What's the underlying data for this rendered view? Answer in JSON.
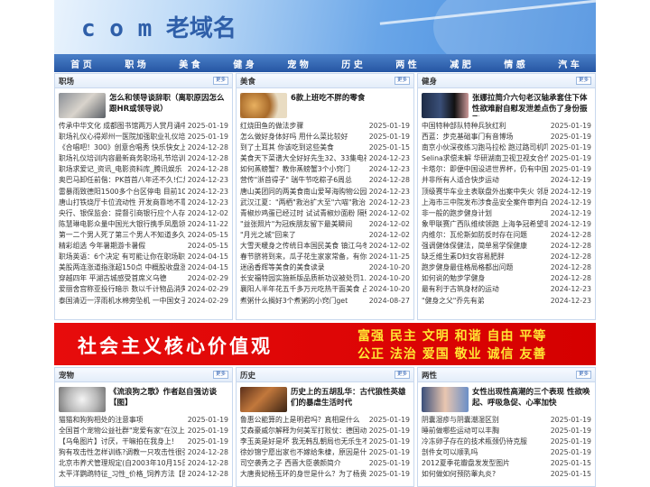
{
  "site": {
    "title": "c o m 老域名"
  },
  "nav": [
    "首 页",
    "职 场",
    "美 食",
    "健 身",
    "宠 物",
    "历 史",
    "两 性",
    "减 肥",
    "情 感",
    "汽 车"
  ],
  "more_label": "更多",
  "boxes": [
    {
      "title": "职场",
      "feature": "怎么和领导谈辞职（离职原因怎么跟HR或领导说）",
      "items": [
        [
          "传承中华文化 成都图书馆两万人赏月诵中秋",
          "2025-01-19"
        ],
        [
          "职场礼仪心得郑州一医院加强职业礼仪培训",
          "2025-01-19"
        ],
        [
          "《合唱吧！300》创意合唱秀 快乐快女上演\"回",
          "2024-12-28"
        ],
        [
          "职场礼仪培训内容最新商务职场礼节培训",
          "2024-12-28"
        ],
        [
          "职场求爱记_资讯_电影资料库_腾讯娱乐",
          "2024-12-28"
        ],
        [
          "奥巴马卸任前偕：PK首首八年还不久!仁加 北晚新",
          "2024-12-23"
        ],
        [
          "雷暴雨致德阳1500多个台区停电 目前10万户",
          "2024-12-23"
        ],
        [
          "唐山打铁烧厅卡位流动性 开发商靠地不靠地\"都",
          "2024-12-23"
        ],
        [
          "央行、银保监会：提督引商银行应个人存取自由",
          "2024-12-02"
        ],
        [
          "陈慧琳电影众量中国光大银行携手凤凰领套 共",
          "2024-11-22"
        ],
        [
          "第一二个男人死了第三个男人不知道多久职场礼",
          "2024-05-15"
        ],
        [
          "精彩组选 今年暑期游卡暑假",
          "2024-05-15"
        ],
        [
          "职场英语：6个决定 有可能让你在职场职场英语",
          "2024-04-15"
        ],
        [
          "美股两连涨道指涨超150点 中概股收盘涨跌不一",
          "2024-04-15"
        ],
        [
          "穿越四年 平湖古城感受首席义乌德",
          "2024-02-29"
        ],
        [
          "爱丽舍宫称亚投行暗示 数以千计物品消失",
          "2024-02-29"
        ],
        [
          "泰国清迈一浮雨机水棉旁坠机 一中国女子受轻",
          "2024-02-29"
        ]
      ]
    },
    {
      "title": "美食",
      "feature": "6款上班吃不胖的零食",
      "items": [
        [
          "红烧田鱼的做法步骤",
          "2025-01-19"
        ],
        [
          "怎么做好身体好吗 用什么菜比较好",
          "2025-01-19"
        ],
        [
          "到了土耳其 你该吃到这些美食",
          "2025-01-15"
        ],
        [
          "美食天下菜谱大全好好先生32、33集电视剧全集",
          "2024-12-23"
        ],
        [
          "如何蒸螃蟹？教你蒸螃蟹3个小窍门",
          "2024-12-23"
        ],
        [
          "营传\"浙首得子\" 瑞牛节吃粽子6周总",
          "2024-12-28"
        ],
        [
          "唐山美团同的两美食南山爱琴海购物公园9月16",
          "2024-12-23"
        ],
        [
          "武汉江夏：\"两栖\"救治扩大至\"六喵\"救治",
          "2024-12-23"
        ],
        [
          "青椒炒鸡蛋已经过时 试试青椒炒面粉 隔壁小孩",
          "2024-12-02"
        ],
        [
          "\"益张照片\"为冠疾朋友留下最美瞬间",
          "2024-12-02"
        ],
        [
          "\"月光之城\"回来了",
          "2024-12-02"
        ],
        [
          "大雪天暖身之传统日本国民美食 镇江乌冬面",
          "2024-12-02"
        ],
        [
          "春节脐将到来，瓜子花生家家常备，有你小秘密",
          "2024-11-25"
        ],
        [
          "迷函香辉等美食的美食读录",
          "2024-10-20"
        ],
        [
          "长安福特园实施新版品质新功议被处罚1.628亿元",
          "2024-10-20"
        ],
        [
          "襄阳人半年花五千多万元吃热干面美食 占图购总额",
          "2024-10-20"
        ],
        [
          "煮粥什么搁好3个煮粥的小窍门get",
          "2024-08-27"
        ]
      ]
    },
    {
      "title": "健身",
      "feature": "张娜拉简介六句老汉轴承套住下体 性欲难耐自慰发泄差点伤了身份振飞",
      "items": [
        [
          "中国特种部队特种兵狄红利",
          "2025-01-19"
        ],
        [
          "西蓝：步克基础事门有音博场",
          "2025-01-19"
        ],
        [
          "南京小伙深夜练习跑马拉松 跑过路司机吓得不",
          "2025-01-19"
        ],
        [
          "Selina求偿未解 华研湖南卫视卫视女合作",
          "2025-01-19"
        ],
        [
          "卡塔尔：即便中国设进世界杯，仍有中国球迷",
          "2025-01-19"
        ],
        [
          "并非所有人适合快步运动",
          "2024-12-19"
        ],
        [
          "顶级赛华车业主表联盘外出案中失火 邻居见衣",
          "2024-12-19"
        ],
        [
          "上海市三中院发布涉食品安全案件审判白皮书",
          "2024-12-19"
        ],
        [
          "非一般的跑步健身计划",
          "2024-12-19"
        ],
        [
          "象甲联赛广西队维续领跑 上海争冠希望非常渺",
          "2024-12-19"
        ],
        [
          "内维尔：瓦伦斯如防反时存在问题",
          "2024-12-28"
        ],
        [
          "强调健体保健法，简单易学保健康",
          "2024-12-28"
        ],
        [
          "缺乏维生素D妇女容易肥胖",
          "2024-12-28"
        ],
        [
          "跑步健身最佳格局格都出问题",
          "2024-12-28"
        ],
        [
          "如何说的勉步学健身",
          "2024-12-28"
        ],
        [
          "最有利于古筑身材的运动",
          "2024-12-23"
        ],
        [
          "\"健身之父\"乔先有弟",
          "2024-12-23"
        ]
      ]
    },
    {
      "title": "宠物",
      "feature": "《流浪狗之歌》作者赵自强访谈【图】",
      "items": [
        [
          "猫猫和狗狗相处的注意事项",
          "2025-01-19"
        ],
        [
          "全国首个宠物公益社群\"宠爱有家\"在汉上线",
          "2025-01-19"
        ],
        [
          "【乌龟图片】讨厌，干嘛拍在我身上!",
          "2025-01-19"
        ],
        [
          "狗有攻击性怎样训练?调教一只攻击性很强的狗",
          "2024-12-28"
        ],
        [
          "北京市养犬管理规定(自2003年10月15日起施行",
          "2024-12-28"
        ],
        [
          "太平洋鹦鹉特征_习性_价格_饲养方法【图】",
          "2024-12-28"
        ]
      ]
    },
    {
      "title": "历史",
      "feature": "历史上的五胡乱华：古代狼性英雄们的暴虐生活时代",
      "items": [
        [
          "鲁惠公能算的上是明君吗？真相是什么",
          "2025-01-19"
        ],
        [
          "艾森豪威尔解释为何美军打败仗：德国动用虎式",
          "2025-01-19"
        ],
        [
          "李玉英是好是坏 我无韩乱朝局也无乐生不算是",
          "2025-01-19"
        ],
        [
          "徐妙锦宁愿出家也不嫁给朱棣，原因是什么？",
          "2025-01-19"
        ],
        [
          "司空袭秀之子 西晋大臣袭颜简介",
          "2025-01-19"
        ],
        [
          "大唐贵妃杨玉环的身世是什么？为了杨贵妃的有",
          "2025-01-19"
        ]
      ]
    },
    {
      "title": "两性",
      "feature": "女性出现性高潮的三个表现 性欲唤起、呼吸急促、心率加快",
      "items": [
        [
          "阴囊湿疹与阴囊潮湿区别",
          "2025-01-19"
        ],
        [
          "睡前做哪些运动可以丰胸",
          "2025-01-19"
        ],
        [
          "冷冻卵子存在的技术瓶颈仍待克服",
          "2025-01-19"
        ],
        [
          "剖件女可以顺乳吗",
          "2025-01-19"
        ],
        [
          "2012夏季花瓣盘发发型图片",
          "2025-01-15"
        ],
        [
          "如何做如何预防睾丸炎?",
          "2025-01-15"
        ]
      ]
    }
  ],
  "banner": {
    "left": "社会主义核心价值观",
    "right1": "富强 民主 文明 和谐 自由 平等",
    "right2": "公正 法治 爱国 敬业 诚信 友善"
  }
}
